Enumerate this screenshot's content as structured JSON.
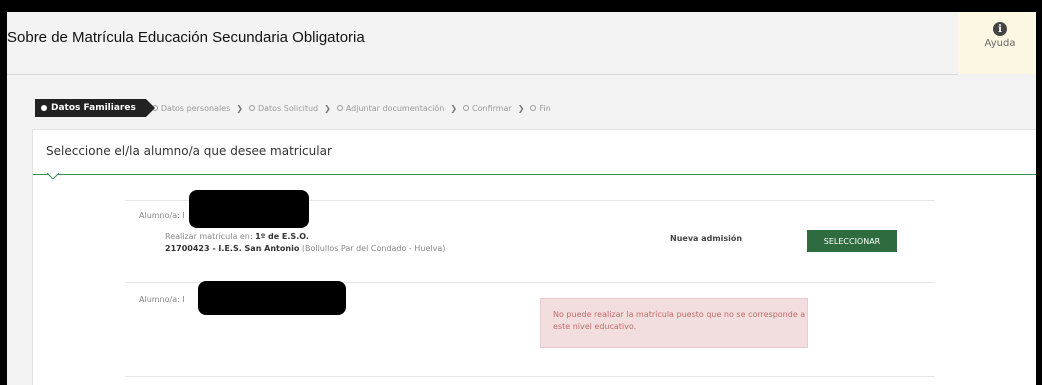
{
  "header": {
    "title": "Sobre de Matrícula Educación Secundaria Obligatoria",
    "help_label": "Ayuda",
    "help_icon": "info-icon"
  },
  "steps": {
    "active": "Datos Familiares",
    "items": [
      "Datos personales",
      "Datos Solicitud",
      "Adjuntar documentación",
      "Confirmar",
      "Fin"
    ]
  },
  "card": {
    "title": "Seleccione el/la alumno/a que desee matricular"
  },
  "students": [
    {
      "label": "Alumno/a: I",
      "matricula_prefix": "Realizar matrícula en:",
      "curso": "1º de E.S.O.",
      "centro_code": "21700423 - I.E.S. San Antonio",
      "centro_location": "(Bollullos Par del Condado - Huelva)",
      "status": "Nueva admisión",
      "button": "SELECCIONAR"
    },
    {
      "label": "Alumno/a: I",
      "alert": "No puede realizar la matrícula puesto que no se corresponde a este nivel educativo."
    }
  ],
  "colors": {
    "accent_green": "#2e6b3f",
    "alert_bg": "#f2dede",
    "alert_text": "#c06b6b",
    "help_bg": "#fbf7e3"
  }
}
